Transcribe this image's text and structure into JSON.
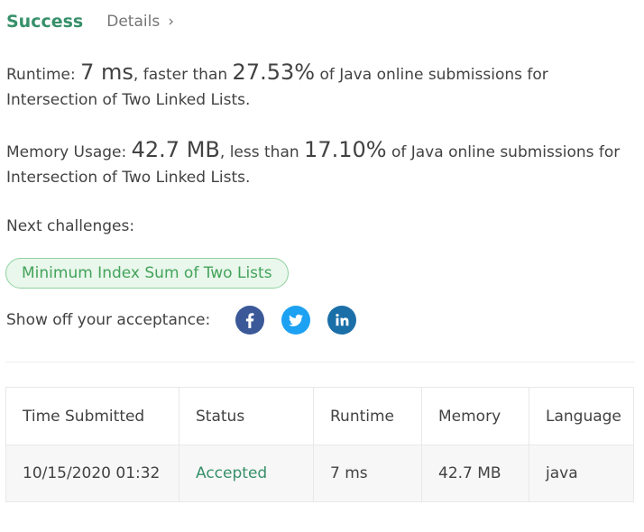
{
  "header": {
    "status": "Success",
    "details_label": "Details",
    "chevron": "›"
  },
  "runtime": {
    "label": "Runtime: ",
    "value": "7 ms",
    "comparison": ", faster than ",
    "percentile": "27.53%",
    "suffix": " of Java online submissions for Intersection of Two Linked Lists."
  },
  "memory": {
    "label": "Memory Usage: ",
    "value": "42.7 MB",
    "comparison": ", less than ",
    "percentile": "17.10%",
    "suffix": " of Java online submissions for Intersection of Two Linked Lists."
  },
  "next_challenges": {
    "label": "Next challenges:",
    "items": [
      "Minimum Index Sum of Two Lists"
    ]
  },
  "share": {
    "label": "Show off your acceptance:",
    "icons": [
      "facebook-icon",
      "twitter-icon",
      "linkedin-icon"
    ]
  },
  "table": {
    "headers": [
      "Time Submitted",
      "Status",
      "Runtime",
      "Memory",
      "Language"
    ],
    "rows": [
      [
        "10/15/2020 01:32",
        "Accepted",
        "7 ms",
        "42.7 MB",
        "java"
      ]
    ]
  },
  "colors": {
    "success": "#37906a",
    "pill_bg": "#e9f7ec",
    "pill_border": "#8fd19e",
    "pill_text": "#43a35a",
    "facebook": "#3b5998",
    "twitter": "#1da1f2",
    "linkedin": "#1b6fa8"
  }
}
